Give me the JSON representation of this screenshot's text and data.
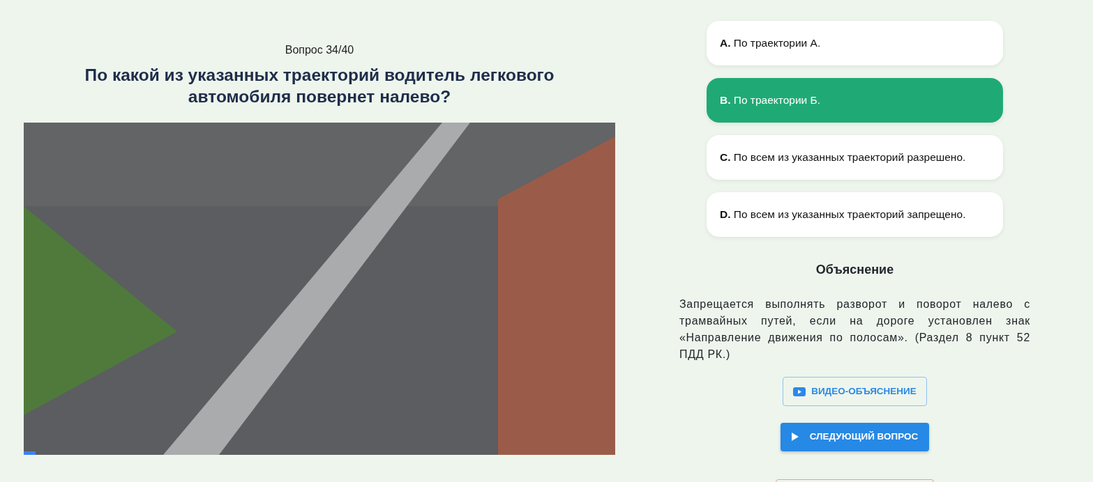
{
  "question": {
    "counter": "Вопрос 34/40",
    "title": "По какой из указанных траекторий водитель легкового автомобиля повернет налево?"
  },
  "video": {
    "level": 0.02
  },
  "answers": [
    {
      "letter": "A.",
      "text": "По траектории А.",
      "selected": false
    },
    {
      "letter": "B.",
      "text": "По траектории Б.",
      "selected": true
    },
    {
      "letter": "C.",
      "text": "По всем из указанных траекторий разрешено.",
      "selected": false
    },
    {
      "letter": "D.",
      "text": "По всем из указанных траекторий запрещено.",
      "selected": false
    }
  ],
  "explanation": {
    "heading": "Объяснение",
    "text": "Запрещается выполнять разворот и поворот налево с трамвайных путей, если на дороге установлен знак «Направление движения по полосам». (Раздел 8 пункт 52 ПДД РК.)"
  },
  "buttons": [
    {
      "kind": "video",
      "label": "ВИДЕО-ОБЪЯСНЕНИЕ"
    },
    {
      "kind": "next",
      "label": "СЛЕДУЮЩИЙ ВОПРОС"
    },
    {
      "kind": "partial"
    }
  ]
}
